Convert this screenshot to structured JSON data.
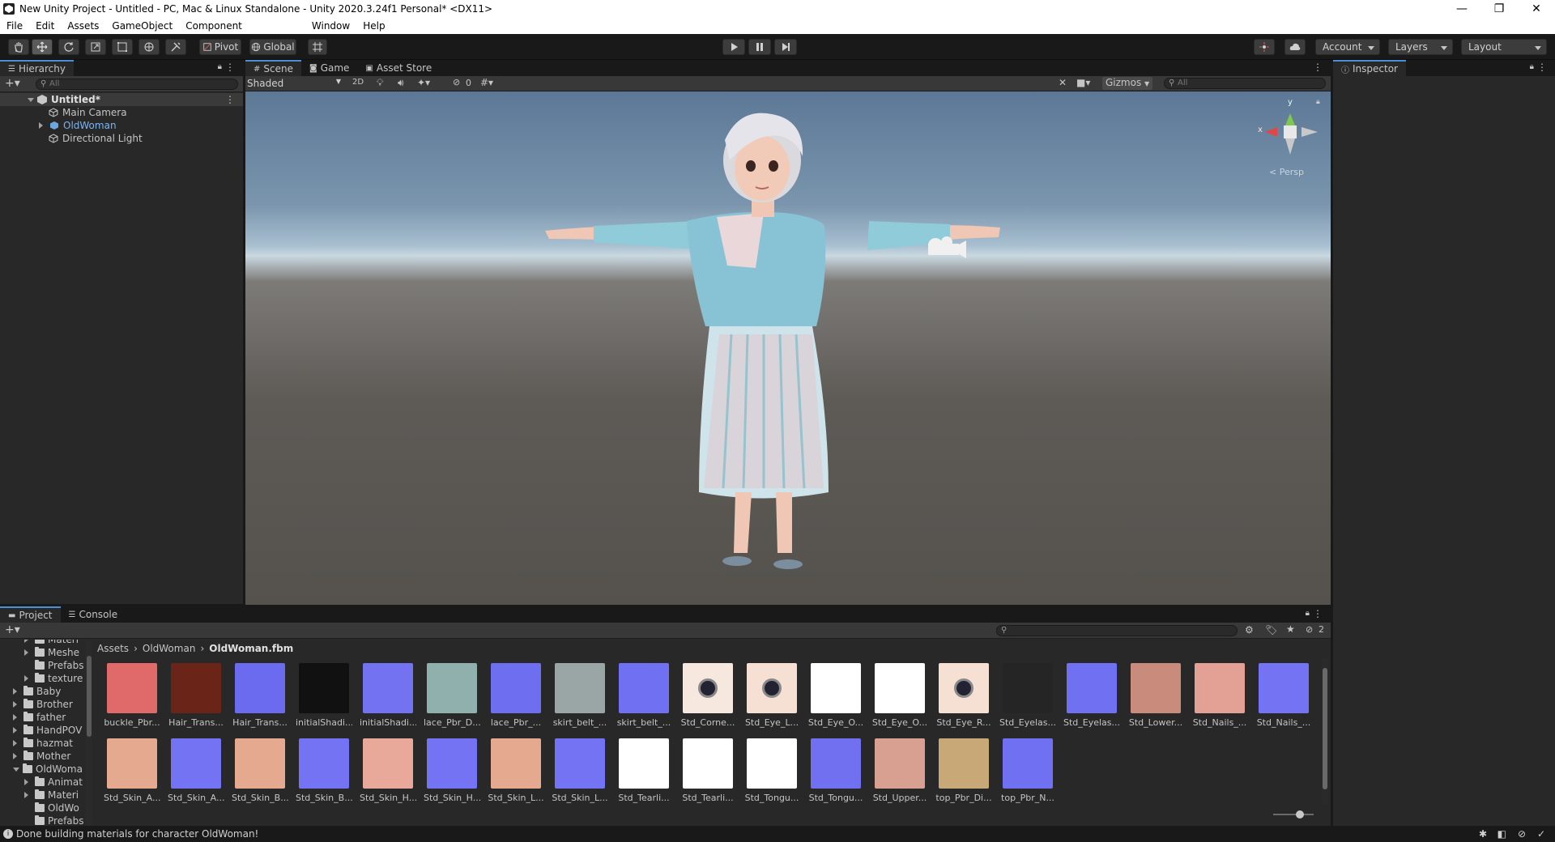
{
  "window": {
    "title": "New Unity Project - Untitled - PC, Mac & Linux Standalone - Unity 2020.3.24f1 Personal* <DX11>",
    "minimize": "—",
    "maximize": "❐",
    "close": "✕"
  },
  "menu": [
    "File",
    "Edit",
    "Assets",
    "GameObject",
    "Component",
    "Window",
    "Help"
  ],
  "toolbar": {
    "pivot_label": "Pivot",
    "global_label": "Global",
    "account_label": "Account",
    "layers_label": "Layers",
    "layout_label": "Layout"
  },
  "hierarchy": {
    "tab_label": "Hierarchy",
    "search_placeholder": "All",
    "scene_name": "Untitled*",
    "items": [
      "Main Camera",
      "OldWoman",
      "Directional Light"
    ]
  },
  "scene": {
    "tabs": [
      "Scene",
      "Game",
      "Asset Store"
    ],
    "draw_mode": "Shaded",
    "mode_2d": "2D",
    "hidden_count": "0",
    "gizmos_label": "Gizmos",
    "search_placeholder": "All",
    "persp_label": "< Persp",
    "axis_x": "x",
    "axis_y": "y"
  },
  "inspector": {
    "tab_label": "Inspector"
  },
  "project": {
    "tabs": [
      "Project",
      "Console"
    ],
    "hidden_count": "2",
    "breadcrumb": [
      "Assets",
      "OldWoman",
      "OldWoman.fbm"
    ],
    "folders": [
      {
        "name": "Materi",
        "indent": 2,
        "expanded": false
      },
      {
        "name": "Meshe",
        "indent": 2,
        "expanded": false
      },
      {
        "name": "Prefabs",
        "indent": 2,
        "expanded": null
      },
      {
        "name": "texture",
        "indent": 2,
        "expanded": false
      },
      {
        "name": "Baby",
        "indent": 1,
        "expanded": false
      },
      {
        "name": "Brother",
        "indent": 1,
        "expanded": false
      },
      {
        "name": "father",
        "indent": 1,
        "expanded": false
      },
      {
        "name": "HandPOV",
        "indent": 1,
        "expanded": false
      },
      {
        "name": "hazmat",
        "indent": 1,
        "expanded": false
      },
      {
        "name": "Mother",
        "indent": 1,
        "expanded": false
      },
      {
        "name": "OldWoma",
        "indent": 1,
        "expanded": true
      },
      {
        "name": "Animat",
        "indent": 2,
        "expanded": false
      },
      {
        "name": "Materi",
        "indent": 2,
        "expanded": false
      },
      {
        "name": "OldWo",
        "indent": 2,
        "expanded": null
      },
      {
        "name": "Prefabs",
        "indent": 2,
        "expanded": null
      }
    ],
    "assets": [
      {
        "label": "buckle_Pbr...",
        "color": "#e06a6a"
      },
      {
        "label": "Hair_Trans...",
        "color": "#6b2418"
      },
      {
        "label": "Hair_Trans...",
        "color": "#6b6bf0"
      },
      {
        "label": "initialShadi...",
        "color": "#111111"
      },
      {
        "label": "initialShadi...",
        "color": "#7373f2"
      },
      {
        "label": "lace_Pbr_D...",
        "color": "#8fb0ac"
      },
      {
        "label": "lace_Pbr_...",
        "color": "#6e6ef0"
      },
      {
        "label": "skirt_belt_...",
        "color": "#9aa6a5"
      },
      {
        "label": "skirt_belt_...",
        "color": "#7070f3"
      },
      {
        "label": "Std_Corne...",
        "color": "#f6e7df"
      },
      {
        "label": "Std_Eye_L...",
        "color": "#f6e0d4"
      },
      {
        "label": "Std_Eye_O...",
        "color": "#ffffff"
      },
      {
        "label": "Std_Eye_O...",
        "color": "#ffffff"
      },
      {
        "label": "Std_Eye_R...",
        "color": "#f6e0d4"
      },
      {
        "label": "Std_Eyelas...",
        "color": "#252525"
      },
      {
        "label": "Std_Eyelas...",
        "color": "#7070f3"
      },
      {
        "label": "Std_Lower...",
        "color": "#c98b7c"
      },
      {
        "label": "Std_Nails_...",
        "color": "#e3a094"
      },
      {
        "label": "Std_Nails_...",
        "color": "#7373f3"
      },
      {
        "label": "Std_Skin_A...",
        "color": "#e5a98f"
      },
      {
        "label": "Std_Skin_A...",
        "color": "#7373f3"
      },
      {
        "label": "Std_Skin_B...",
        "color": "#e5a98f"
      },
      {
        "label": "Std_Skin_B...",
        "color": "#7373f3"
      },
      {
        "label": "Std_Skin_H...",
        "color": "#e8a99a"
      },
      {
        "label": "Std_Skin_H...",
        "color": "#7373f3"
      },
      {
        "label": "Std_Skin_L...",
        "color": "#e5a98f"
      },
      {
        "label": "Std_Skin_L...",
        "color": "#7373f3"
      },
      {
        "label": "Std_Tearli...",
        "color": "#ffffff"
      },
      {
        "label": "Std_Tearli...",
        "color": "#ffffff"
      },
      {
        "label": "Std_Tongu...",
        "color": "#ffffff"
      },
      {
        "label": "Std_Tongu...",
        "color": "#7070f0"
      },
      {
        "label": "Std_Upper...",
        "color": "#d7a090"
      },
      {
        "label": "top_Pbr_Di...",
        "color": "#c9a878"
      },
      {
        "label": "top_Pbr_N...",
        "color": "#7070f3"
      }
    ]
  },
  "status": {
    "message": "Done building materials for character OldWoman!"
  }
}
